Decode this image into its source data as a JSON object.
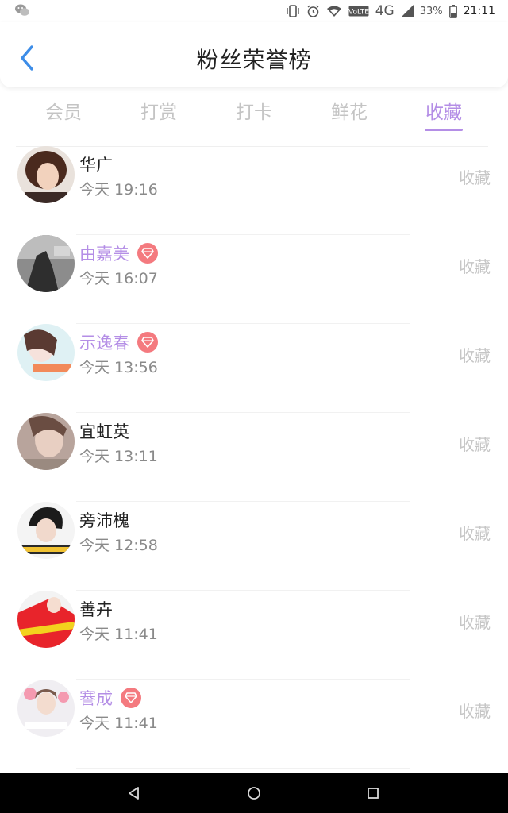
{
  "status_bar": {
    "network": "4G",
    "battery": "33%",
    "time": "21:11",
    "icons": [
      "wechat-icon",
      "vibrate-icon",
      "alarm-icon",
      "wifi-icon",
      "volte-icon",
      "signal-icon",
      "battery-icon"
    ]
  },
  "header": {
    "title": "粉丝荣誉榜",
    "back_icon": "chevron-left-icon"
  },
  "tabs": [
    {
      "label": "会员",
      "active": false
    },
    {
      "label": "打赏",
      "active": false
    },
    {
      "label": "打卡",
      "active": false
    },
    {
      "label": "鲜花",
      "active": false
    },
    {
      "label": "收藏",
      "active": true
    }
  ],
  "colors": {
    "accent": "#b48ee6",
    "vip_badge": "#f47a7f",
    "muted_text": "#c6c6c6"
  },
  "list": [
    {
      "name": "华广",
      "time": "今天 19:16",
      "action": "收藏",
      "vip": false
    },
    {
      "name": "由嘉美",
      "time": "今天 16:07",
      "action": "收藏",
      "vip": true
    },
    {
      "name": "示逸春",
      "time": "今天 13:56",
      "action": "收藏",
      "vip": true
    },
    {
      "name": "宜虹英",
      "time": "今天 13:11",
      "action": "收藏",
      "vip": false
    },
    {
      "name": "旁沛槐",
      "time": "今天 12:58",
      "action": "收藏",
      "vip": false
    },
    {
      "name": "善卉",
      "time": "今天 11:41",
      "action": "收藏",
      "vip": false
    },
    {
      "name": "謇成",
      "time": "今天 11:41",
      "action": "收藏",
      "vip": true
    }
  ],
  "nav_bar": {
    "buttons": [
      "back-triangle-icon",
      "home-circle-icon",
      "recents-square-icon"
    ]
  }
}
